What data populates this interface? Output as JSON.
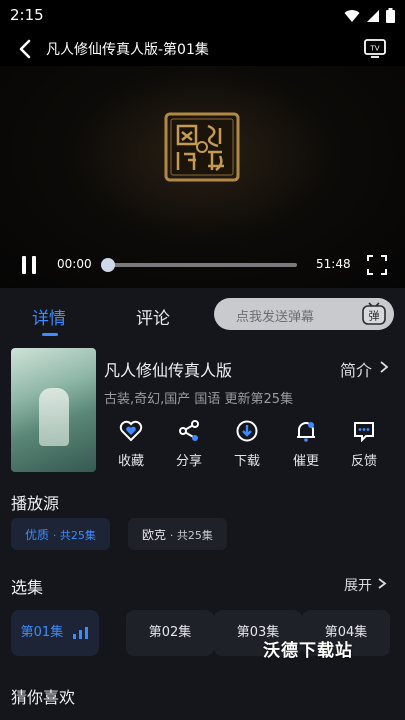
{
  "status": {
    "time": "2:15"
  },
  "header": {
    "title": "凡人修仙传真人版-第01集"
  },
  "player": {
    "current_time": "00:00",
    "total_time": "51:48",
    "progress": 0.02
  },
  "tabs": [
    {
      "label": "详情",
      "active": true
    },
    {
      "label": "评论",
      "active": false
    }
  ],
  "danmaku": {
    "placeholder": "点我发送弹幕",
    "icon_label": "弹"
  },
  "show": {
    "title": "凡人修仙传真人版",
    "intro_label": "简介",
    "meta": "古装,奇幻,国产 国语 更新第25集"
  },
  "actions": [
    {
      "label": "收藏",
      "icon": "heart-icon"
    },
    {
      "label": "分享",
      "icon": "share-icon"
    },
    {
      "label": "下载",
      "icon": "download-icon"
    },
    {
      "label": "催更",
      "icon": "bell-icon"
    },
    {
      "label": "反馈",
      "icon": "feedback-icon"
    }
  ],
  "sources": {
    "title": "播放源",
    "items": [
      {
        "name": "优质",
        "count": "· 共25集",
        "selected": true
      },
      {
        "name": "欧克",
        "count": "· 共25集",
        "selected": false
      }
    ]
  },
  "episodes": {
    "title": "选集",
    "expand_label": "展开",
    "items": [
      {
        "label": "第01集",
        "selected": true
      },
      {
        "label": "第02集",
        "selected": false
      },
      {
        "label": "第03集",
        "selected": false
      },
      {
        "label": "第04集",
        "selected": false
      }
    ]
  },
  "recommend": {
    "title": "猜你喜欢"
  },
  "watermark": "沃德下载站",
  "colors": {
    "accent": "#3d8bff",
    "background": "#15161c"
  }
}
